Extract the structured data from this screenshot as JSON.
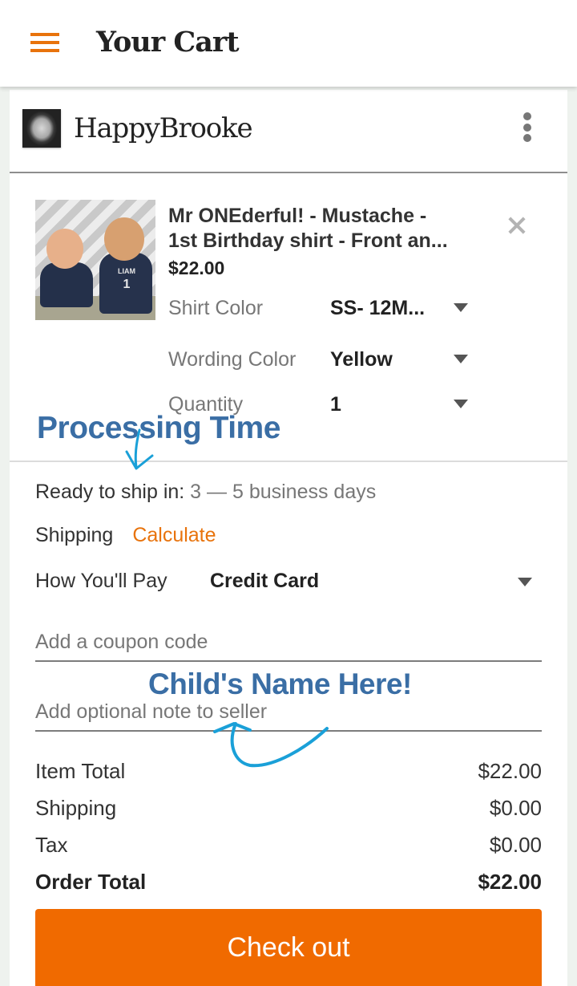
{
  "appbar": {
    "title": "Your Cart",
    "menu_icon": "hamburger-menu-icon"
  },
  "shop": {
    "name": "HappyBrooke",
    "more_icon": "more-vertical-icon"
  },
  "item": {
    "title_line1": "Mr ONEderful! - Mustache -",
    "title_line2": "1st Birthday shirt - Front an...",
    "price": "$22.00",
    "image_text_name": "LIAM",
    "image_text_number": "1",
    "remove_icon": "close-icon",
    "options": [
      {
        "label": "Shirt Color",
        "value": "SS- 12M..."
      },
      {
        "label": "Wording Color",
        "value": "Yellow"
      },
      {
        "label": "Quantity",
        "value": "1"
      }
    ]
  },
  "shipping_info": {
    "ready_label": "Ready to ship in:",
    "ready_value": "3 — 5 business days",
    "shipping_label": "Shipping",
    "calculate_link": "Calculate"
  },
  "payment": {
    "label": "How You'll Pay",
    "value": "Credit Card"
  },
  "inputs": {
    "coupon_placeholder": "Add a coupon code",
    "note_placeholder": "Add optional note to seller"
  },
  "annotations": {
    "processing_time": "Processing Time",
    "childs_name": "Child's Name Here!",
    "color": "#3a6ea5",
    "arrow_color": "#1aa0d8"
  },
  "summary": {
    "rows": [
      {
        "label": "Item Total",
        "value": "$22.00"
      },
      {
        "label": "Shipping",
        "value": "$0.00"
      },
      {
        "label": "Tax",
        "value": "$0.00"
      }
    ],
    "total_label": "Order Total",
    "total_value": "$22.00"
  },
  "checkout": {
    "label": "Check out",
    "color": "#f06a00"
  },
  "colors": {
    "accent": "#e8730c"
  }
}
